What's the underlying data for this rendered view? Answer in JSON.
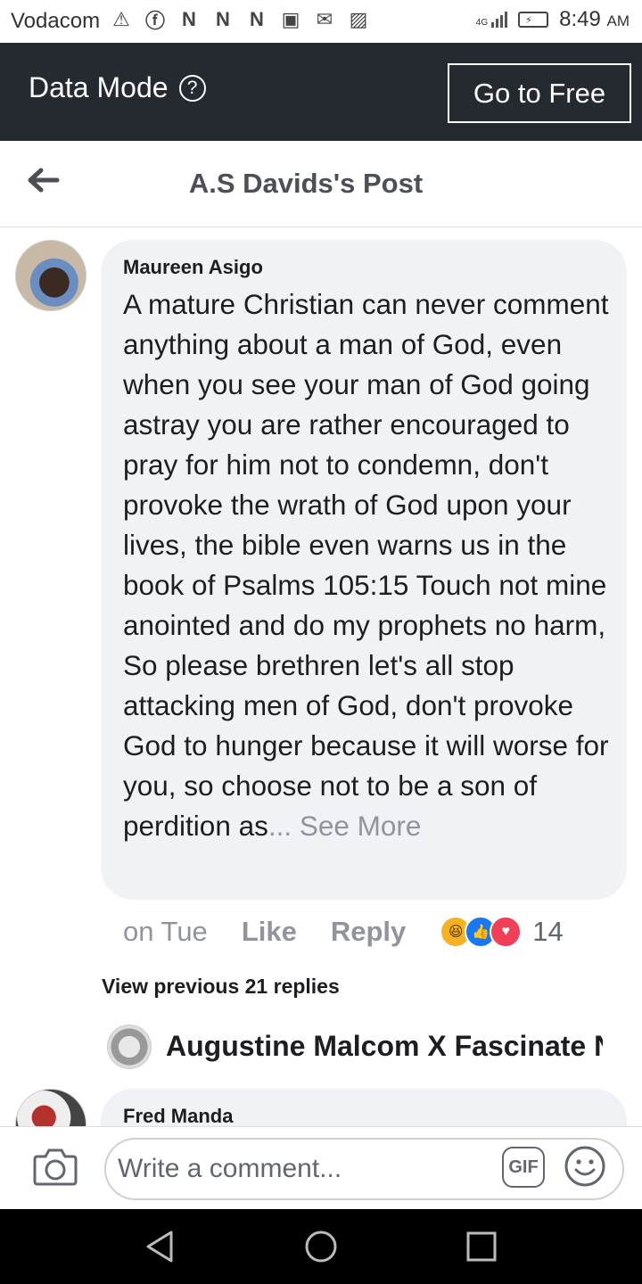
{
  "status_bar": {
    "carrier": "Vodacom",
    "network": "4G",
    "time": "8:49",
    "ampm": "AM"
  },
  "data_mode": {
    "label": "Data Mode",
    "button": "Go to Free"
  },
  "header": {
    "title": "A.S Davids's Post"
  },
  "comment": {
    "author": "Maureen Asigo",
    "text": "A mature Christian  can never comment anything  about a man of God, even when you see your man of God going astray  you are rather encouraged  to pray for him not to condemn, don't  provoke the wrath of God upon your lives, the bible even  warns us in the book of Psalms 105:15 Touch not mine anointed  and do my prophets  no harm, So please brethren let's  all stop attacking men of God, don't provoke God to hunger because it will worse for you, so choose not to be a son of perdition  as",
    "see_more": "... See More",
    "time": "on Tue",
    "like": "Like",
    "reply": "Reply",
    "reaction_count": "14"
  },
  "replies": {
    "view_previous": "View previous 21 replies",
    "reply_author": "Augustine Malcom X Fascinate N"
  },
  "next_comment": {
    "author": "Fred Manda"
  },
  "composer": {
    "placeholder": "Write a comment...",
    "gif": "GIF"
  }
}
